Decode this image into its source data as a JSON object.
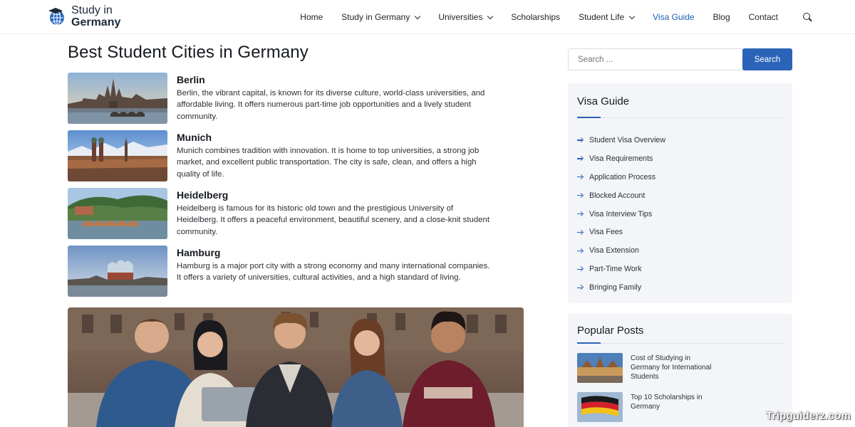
{
  "header": {
    "logo": {
      "line1": "Study in",
      "line2": "Germany"
    },
    "nav": [
      {
        "label": "Home",
        "dropdown": false,
        "active": false
      },
      {
        "label": "Study in Germany",
        "dropdown": true,
        "active": false
      },
      {
        "label": "Universities",
        "dropdown": true,
        "active": false
      },
      {
        "label": "Scholarships",
        "dropdown": false,
        "active": false
      },
      {
        "label": "Student Life",
        "dropdown": true,
        "active": false
      },
      {
        "label": "Visa Guide",
        "dropdown": false,
        "active": true
      },
      {
        "label": "Blog",
        "dropdown": false,
        "active": false
      },
      {
        "label": "Contact",
        "dropdown": false,
        "active": false
      }
    ],
    "search_icon": "search-icon"
  },
  "main": {
    "title": "Best Student Cities in Germany",
    "cities": [
      {
        "name": "Berlin",
        "description": "Berlin, the vibrant capital, is known for its diverse culture, world-class universities, and affordable living. It offers numerous part-time job opportunities and a lively student community."
      },
      {
        "name": "Munich",
        "description": "Munich combines tradition with innovation. It is home to top universities, a strong job market, and excellent public transportation. The city is safe, clean, and offers a high quality of life."
      },
      {
        "name": "Heidelberg",
        "description": "Heidelberg is famous for its historic old town and the prestigious University of Heidelberg. It offers a peaceful environment, beautiful scenery, and a close-knit student community."
      },
      {
        "name": "Hamburg",
        "description": "Hamburg is a major port city with a strong economy and many international companies. It offers a variety of universities, cultural activities, and a high standard of living."
      }
    ]
  },
  "sidebar": {
    "search": {
      "placeholder": "Search ...",
      "button_label": "Search"
    },
    "visa_guide": {
      "title": "Visa Guide",
      "items": [
        "Student Visa Overview",
        "Visa Requirements",
        "Application Process",
        "Blocked Account",
        "Visa Interview Tips",
        "Visa Fees",
        "Visa Extension",
        "Part-Time Work",
        "Bringing Family"
      ]
    },
    "popular_posts": {
      "title": "Popular Posts",
      "posts": [
        {
          "title": "Cost of Studying in Germany for International Students"
        },
        {
          "title": "Top 10 Scholarships in Germany"
        }
      ]
    }
  },
  "watermark": "Tripguiderz.com",
  "colors": {
    "accent": "#2b63b8",
    "active_nav": "#1f5fb5",
    "widget_bg": "#f3f5f8"
  }
}
